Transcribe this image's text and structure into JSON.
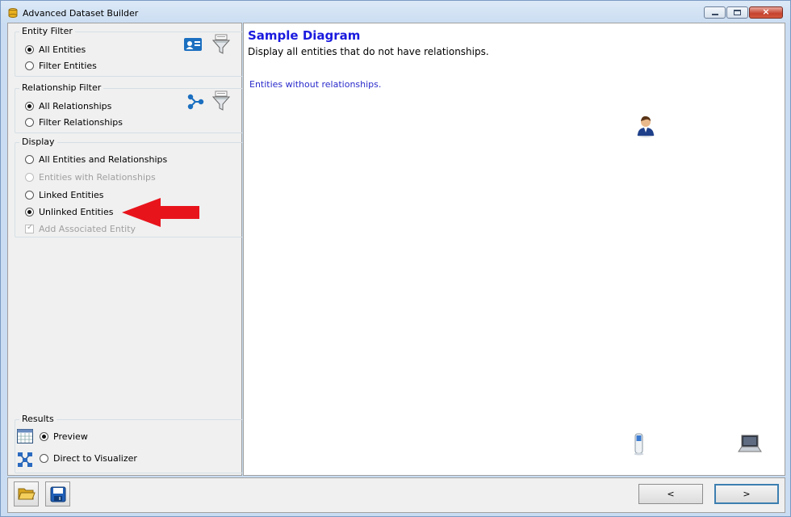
{
  "window": {
    "title": "Advanced Dataset Builder"
  },
  "entity_filter": {
    "label": "Entity Filter",
    "options": [
      {
        "label": "All Entities",
        "checked": true
      },
      {
        "label": "Filter Entities",
        "checked": false
      }
    ],
    "icons": [
      "entity-card-icon",
      "funnel-filter-icon"
    ]
  },
  "relationship_filter": {
    "label": "Relationship Filter",
    "options": [
      {
        "label": "All Relationships",
        "checked": true
      },
      {
        "label": "Filter Relationships",
        "checked": false
      }
    ],
    "icons": [
      "relationship-icon",
      "funnel-filter-icon"
    ]
  },
  "display": {
    "label": "Display",
    "options": [
      {
        "label": "All Entities and Relationships",
        "checked": false,
        "disabled": false
      },
      {
        "label": "Entities with Relationships",
        "checked": false,
        "disabled": true
      },
      {
        "label": "Linked Entities",
        "checked": false,
        "disabled": false
      },
      {
        "label": "Unlinked Entities",
        "checked": true,
        "disabled": false
      }
    ],
    "add_associated": {
      "label": "Add Associated Entity",
      "checked": true,
      "disabled": true
    }
  },
  "results": {
    "label": "Results",
    "options": [
      {
        "label": "Preview",
        "checked": true,
        "icon": "grid-table-icon"
      },
      {
        "label": "Direct to Visualizer",
        "checked": false,
        "icon": "network-nodes-icon"
      }
    ]
  },
  "diagram": {
    "title": "Sample Diagram",
    "description": "Display all entities that do not have relationships.",
    "node_label": "Entities without relationships."
  },
  "footer": {
    "back_label": "<",
    "next_label": ">"
  },
  "colors": {
    "accent": "#1a1adf",
    "arrow": "#e8141c"
  }
}
